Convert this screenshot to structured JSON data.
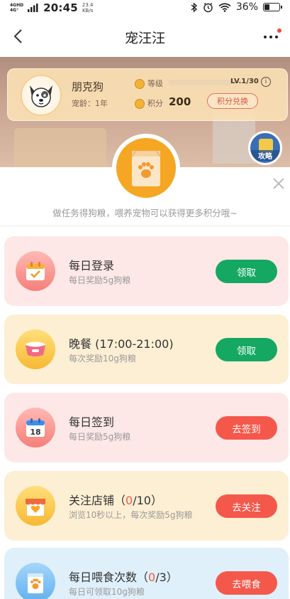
{
  "status_bar": {
    "network_1": "4GHD",
    "network_2": "4G⁺",
    "time": "20:45",
    "speed_value": "23.4",
    "speed_unit": "KB/s",
    "battery": "36%",
    "battery_level_fraction": 0.36
  },
  "nav": {
    "title": "宠汪汪"
  },
  "profile": {
    "pet_name": "朋克狗",
    "pet_age": "宠龄：1年",
    "level_label": "等级",
    "level_value": "LV.1/30",
    "level_progress_fraction": 0.0,
    "points_label": "积分",
    "points_value": "200",
    "exchange_button": "积分兑换"
  },
  "strategy": {
    "label": "攻略"
  },
  "panel": {
    "subtitle": "做任务得狗粮，喂养宠物可以获得更多积分哦~"
  },
  "tasks": [
    {
      "title": "每日登录",
      "desc": "每日奖励5g狗粮",
      "button": "领取",
      "icon": "calendar-check-icon"
    },
    {
      "title": "晚餐 (17:00-21:00)",
      "desc": "每次奖励10g狗粮",
      "button": "领取",
      "icon": "pet-bowl-icon"
    },
    {
      "title": "每日签到",
      "desc": "每日奖励5g狗粮",
      "button": "去签到",
      "icon": "calendar-18-icon",
      "calendar_day": "18"
    },
    {
      "title_prefix": "关注店铺（",
      "count_cur": "0",
      "title_suffix": "/10）",
      "desc": "浏览10秒以上，每次奖励5g狗粮",
      "button": "去关注",
      "icon": "shop-heart-icon"
    },
    {
      "title_prefix": "每日喂食次数（",
      "count_cur": "0",
      "title_suffix": "/3）",
      "desc": "每日可领取10g狗粮",
      "button": "去喂食",
      "icon": "food-bag-icon"
    }
  ],
  "colors": {
    "green_button": "#15a862",
    "red_button": "#f4584b",
    "pink_card": "#fde8e7",
    "yellow_card": "#fdefd4",
    "blue_card": "#dff0fb"
  }
}
